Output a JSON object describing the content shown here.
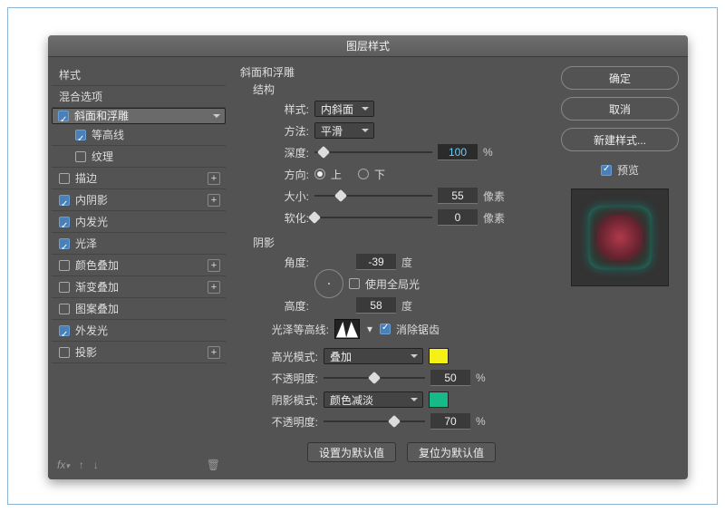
{
  "title": "图层样式",
  "sidebar": {
    "header": "样式",
    "blend": "混合选项",
    "items": [
      {
        "label": "斜面和浮雕",
        "checked": true,
        "selected": true,
        "plus": false,
        "child": false
      },
      {
        "label": "等高线",
        "checked": true,
        "selected": false,
        "plus": false,
        "child": true
      },
      {
        "label": "纹理",
        "checked": false,
        "selected": false,
        "plus": false,
        "child": true
      },
      {
        "label": "描边",
        "checked": false,
        "selected": false,
        "plus": true,
        "child": false
      },
      {
        "label": "内阴影",
        "checked": true,
        "selected": false,
        "plus": true,
        "child": false
      },
      {
        "label": "内发光",
        "checked": true,
        "selected": false,
        "plus": false,
        "child": false
      },
      {
        "label": "光泽",
        "checked": true,
        "selected": false,
        "plus": false,
        "child": false
      },
      {
        "label": "颜色叠加",
        "checked": false,
        "selected": false,
        "plus": true,
        "child": false
      },
      {
        "label": "渐变叠加",
        "checked": false,
        "selected": false,
        "plus": true,
        "child": false
      },
      {
        "label": "图案叠加",
        "checked": false,
        "selected": false,
        "plus": false,
        "child": false
      },
      {
        "label": "外发光",
        "checked": true,
        "selected": false,
        "plus": false,
        "child": false
      },
      {
        "label": "投影",
        "checked": false,
        "selected": false,
        "plus": true,
        "child": false
      }
    ]
  },
  "panel": {
    "heading": "斜面和浮雕",
    "structure": {
      "title": "结构",
      "styleLabel": "样式:",
      "styleValue": "内斜面",
      "methodLabel": "方法:",
      "methodValue": "平滑",
      "depthLabel": "深度:",
      "depthValue": "100",
      "depthUnit": "%",
      "dirLabel": "方向:",
      "dirUp": "上",
      "dirDown": "下",
      "sizeLabel": "大小:",
      "sizeValue": "55",
      "sizeUnit": "像素",
      "softLabel": "软化:",
      "softValue": "0",
      "softUnit": "像素"
    },
    "shading": {
      "title": "阴影",
      "angleLabel": "角度:",
      "angleValue": "-39",
      "deg": "度",
      "globalLabel": "使用全局光",
      "altLabel": "高度:",
      "altValue": "58",
      "glossLabel": "光泽等高线:",
      "aaLabel": "消除锯齿",
      "hlModeLabel": "高光模式:",
      "hlModeValue": "叠加",
      "hlOpLabel": "不透明度:",
      "hlOpValue": "50",
      "pct": "%",
      "shModeLabel": "阴影模式:",
      "shModeValue": "颜色减淡",
      "shOpLabel": "不透明度:",
      "shOpValue": "70"
    },
    "footer": {
      "default": "设置为默认值",
      "reset": "复位为默认值"
    },
    "colors": {
      "highlight": "#f5f016",
      "shadow": "#18b889"
    }
  },
  "right": {
    "ok": "确定",
    "cancel": "取消",
    "new": "新建样式...",
    "previewLabel": "预览"
  }
}
